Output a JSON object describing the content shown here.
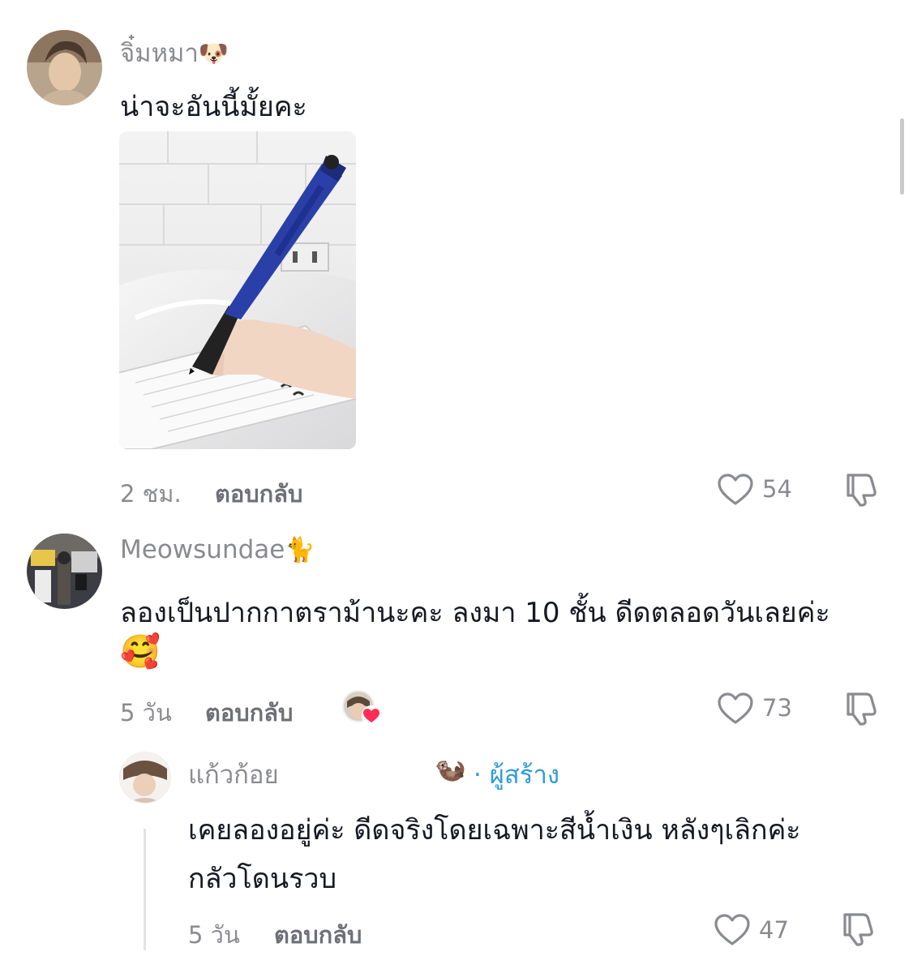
{
  "comments": [
    {
      "username": "จิ๋มหมา",
      "username_emoji": "🐶",
      "text": "น่าจะอันนี้มั้ยคะ",
      "time": "2 ชม.",
      "reply_label": "ตอบกลับ",
      "likes": "54"
    },
    {
      "username": "Meowsundae",
      "username_emoji": "🐈",
      "text_line1": "ลองเป็นปากกาตราม้านะคะ ลงมา 10 ชั้น ดีดตลอดวันเลยค่ะ",
      "text_line2": "🥰",
      "time": "5 วัน",
      "reply_label": "ตอบกลับ",
      "likes": "73"
    }
  ],
  "reply": {
    "username": "แก้วก้อย",
    "username_emoji": "🦦",
    "creator_label": "· ผู้สร้าง",
    "text_line1": "เคยลองอยู่ค่ะ ดีดจริงโดยเฉพาะสีน้ำเงิน หลังๆเลิกค่ะ",
    "text_line2": "กลัวโดนรวบ",
    "time": "5 วัน",
    "reply_label": "ตอบกลับ",
    "likes": "47"
  },
  "colors": {
    "secondary_text": "#8a8b91",
    "creator_blue": "#2d9cdb",
    "heart_badge": "#fe2c55"
  },
  "icons": [
    "heart-outline-icon",
    "thumbs-down-icon",
    "creator-liked-heart-icon"
  ]
}
